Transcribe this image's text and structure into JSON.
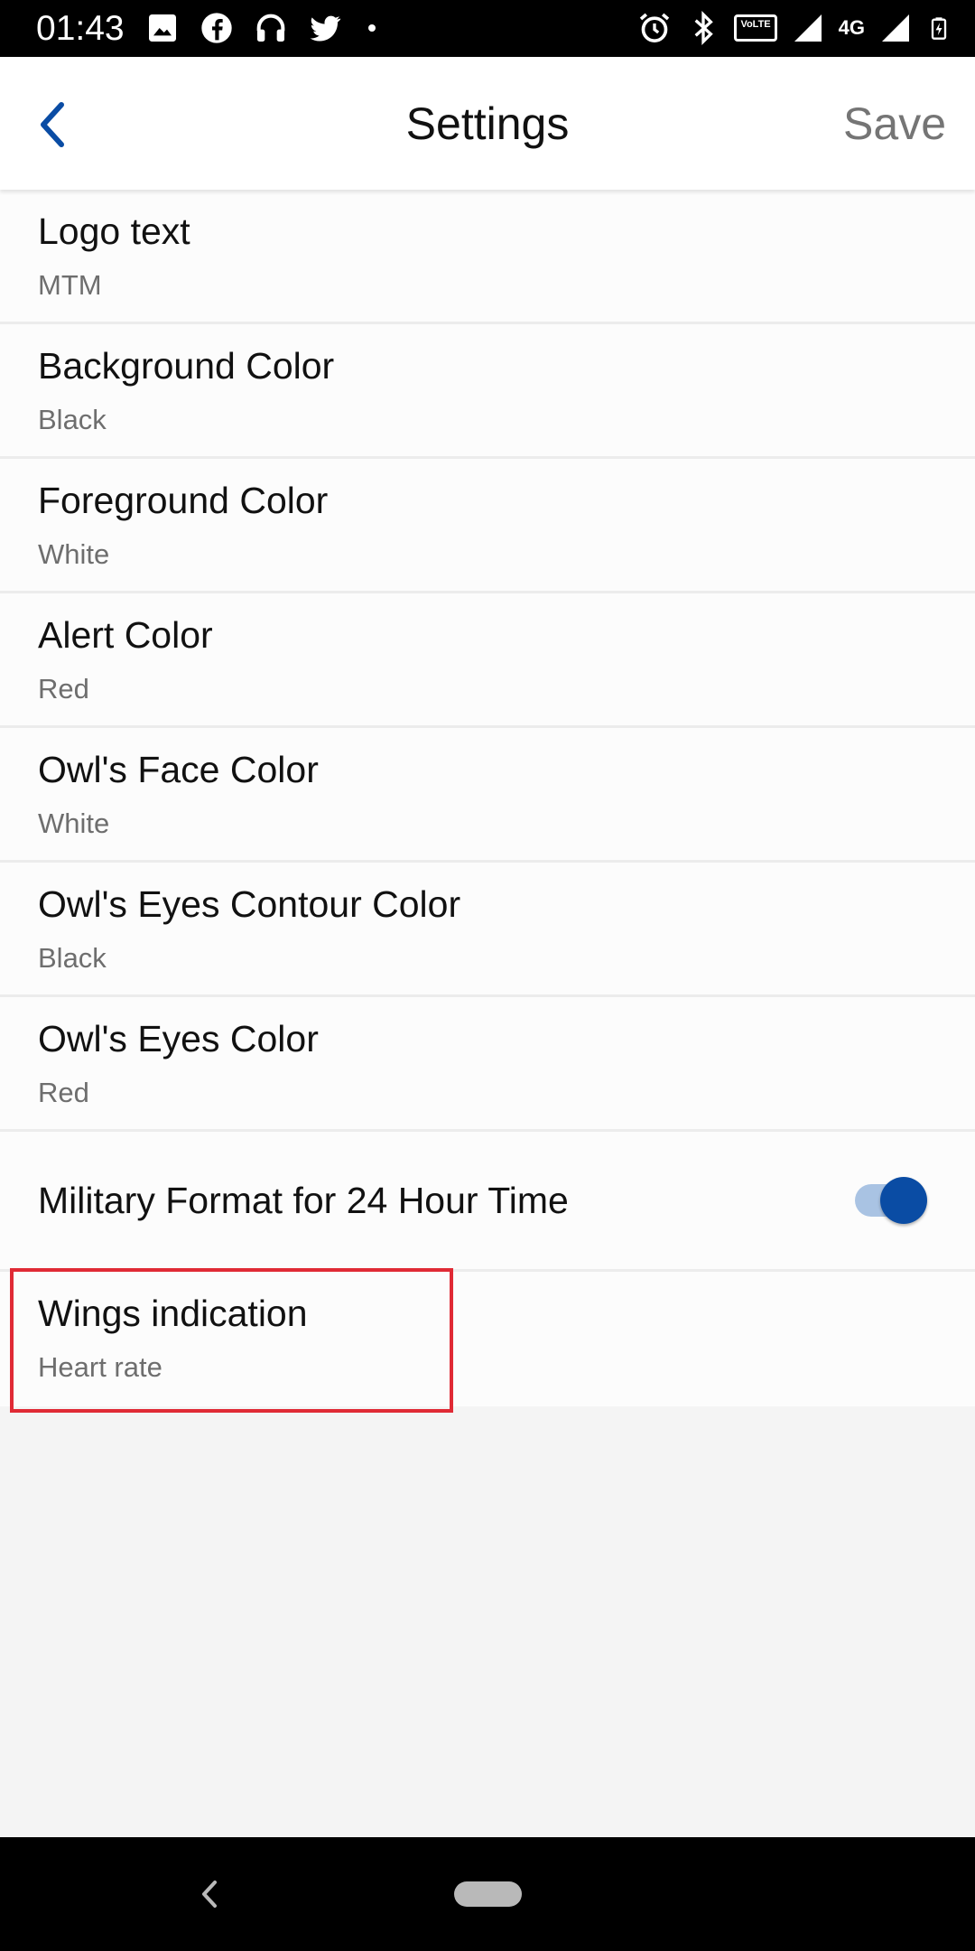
{
  "status_bar": {
    "time": "01:43",
    "left_icons": [
      "image-icon",
      "facebook-icon",
      "headphones-icon",
      "twitter-icon",
      "dot-icon"
    ],
    "right_icons": [
      "alarm-icon",
      "bluetooth-icon",
      "volte-icon",
      "signal-icon",
      "4g-icon",
      "signal-icon",
      "battery-charging-icon"
    ],
    "volte_label": "VoLTE",
    "network_label": "4G"
  },
  "app_bar": {
    "title": "Settings",
    "save_label": "Save",
    "back_icon": "chevron-left-icon"
  },
  "settings": [
    {
      "title": "Logo text",
      "value": "MTM"
    },
    {
      "title": "Background Color",
      "value": "Black"
    },
    {
      "title": "Foreground Color",
      "value": "White"
    },
    {
      "title": "Alert Color",
      "value": "Red"
    },
    {
      "title": "Owl's Face Color",
      "value": "White"
    },
    {
      "title": "Owl's Eyes Contour Color",
      "value": "Black"
    },
    {
      "title": "Owl's Eyes Color",
      "value": "Red"
    }
  ],
  "toggle_setting": {
    "label": "Military Format for 24 Hour Time",
    "enabled": true
  },
  "wings_setting": {
    "title": "Wings indication",
    "value": "Heart rate"
  },
  "colors": {
    "accent": "#0a4ca4",
    "highlight": "#e02a35"
  },
  "nav_bar": {
    "icons": [
      "nav-back-icon",
      "home-pill-icon"
    ]
  }
}
